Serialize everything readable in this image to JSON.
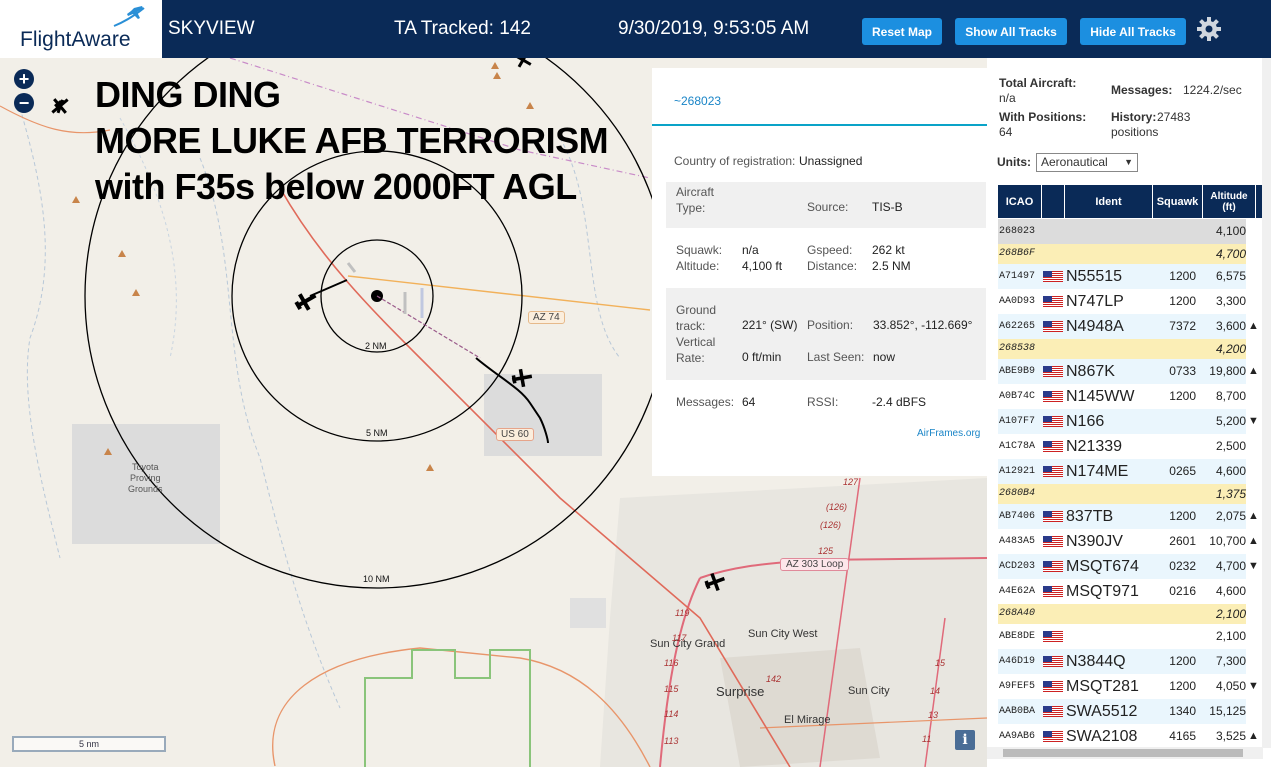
{
  "header": {
    "brand": "FlightAware",
    "title": "SKYVIEW",
    "ta_tracked": "TA Tracked: 142",
    "datetime": "9/30/2019, 9:53:05 AM",
    "buttons": {
      "reset": "Reset Map",
      "show": "Show All Tracks",
      "hide": "Hide All Tracks"
    }
  },
  "map": {
    "zoom_in": "+",
    "zoom_out": "−",
    "overlay": [
      "DING DING",
      "MORE LUKE AFB TERRORISM",
      "with F35s below 2000FT AGL"
    ],
    "range_rings": [
      "2 NM",
      "5 NM",
      "10 NM"
    ],
    "road_labels": [
      "AZ 74",
      "US 60",
      "AZ 303 Loop"
    ],
    "places": {
      "proving": "Toyota\nProving\nGrounds",
      "sun_city_grand": "Sun City Grand",
      "sun_city_west": "Sun City West",
      "surprise": "Surprise",
      "sun_city": "Sun City",
      "el_mirage": "El Mirage"
    },
    "road_numbers": [
      "127",
      "(126)",
      "(126)",
      "125",
      "119",
      "117",
      "116",
      "115",
      "114",
      "113",
      "142",
      "15",
      "14",
      "13",
      "12",
      "11"
    ],
    "scale": "5 nm",
    "info": "i"
  },
  "popup": {
    "icao": "~268023",
    "country_label": "Country of registration:",
    "country_value": "Unassigned",
    "aircraft_type_label": "Aircraft\nType:",
    "source_label": "Source:",
    "source_value": "TIS-B",
    "squawk_label": "Squawk:",
    "squawk_value": "n/a",
    "altitude_label": "Altitude:",
    "altitude_value": "4,100 ft",
    "gspeed_label": "Gspeed:",
    "gspeed_value": "262 kt",
    "distance_label": "Distance:",
    "distance_value": "2.5 NM",
    "ground_track_label": "Ground\ntrack:",
    "ground_track_value": "221° (SW)",
    "position_label": "Position:",
    "position_value": "33.852°, -112.669°",
    "vrate_label": "Vertical\nRate:",
    "vrate_value": "0 ft/min",
    "lastseen_label": "Last Seen:",
    "lastseen_value": "now",
    "messages_label": "Messages:",
    "messages_value": "64",
    "rssi_label": "RSSI:",
    "rssi_value": "-2.4 dBFS",
    "airframes": "AirFrames.org"
  },
  "stats": {
    "total_label": "Total Aircraft:",
    "total_value": "n/a",
    "messages_label": "Messages:",
    "messages_value": "1224.2/sec",
    "positions_label": "With Positions:",
    "positions_value": "64",
    "history_label": "History:",
    "history_value": "27483",
    "history_suffix": "positions",
    "units_label": "Units:",
    "units_value": "Aeronautical"
  },
  "table": {
    "headers": [
      "ICAO",
      "",
      "Ident",
      "Squawk",
      "Altitude\n(ft)"
    ],
    "rows": [
      {
        "icao": "268023",
        "flag": false,
        "ident": "",
        "squawk": "",
        "alt": "4,100",
        "trend": "",
        "style": "grey"
      },
      {
        "icao": "268B6F",
        "flag": false,
        "ident": "",
        "squawk": "",
        "alt": "4,700",
        "trend": "",
        "style": "mil"
      },
      {
        "icao": "A71497",
        "flag": true,
        "ident": "N55515",
        "squawk": "1200",
        "alt": "6,575",
        "trend": "",
        "style": "blue"
      },
      {
        "icao": "AA0D93",
        "flag": true,
        "ident": "N747LP",
        "squawk": "1200",
        "alt": "3,300",
        "trend": "",
        "style": "white"
      },
      {
        "icao": "A62265",
        "flag": true,
        "ident": "N4948A",
        "squawk": "7372",
        "alt": "3,600",
        "trend": "▲",
        "style": "blue"
      },
      {
        "icao": "268538",
        "flag": false,
        "ident": "",
        "squawk": "",
        "alt": "4,200",
        "trend": "",
        "style": "mil"
      },
      {
        "icao": "ABE9B9",
        "flag": true,
        "ident": "N867K",
        "squawk": "0733",
        "alt": "19,800",
        "trend": "▲",
        "style": "blue"
      },
      {
        "icao": "A0B74C",
        "flag": true,
        "ident": "N145WW",
        "squawk": "1200",
        "alt": "8,700",
        "trend": "",
        "style": "white"
      },
      {
        "icao": "A107F7",
        "flag": true,
        "ident": "N166",
        "squawk": "",
        "alt": "5,200",
        "trend": "▼",
        "style": "blue"
      },
      {
        "icao": "A1C78A",
        "flag": true,
        "ident": "N21339",
        "squawk": "",
        "alt": "2,500",
        "trend": "",
        "style": "white"
      },
      {
        "icao": "A12921",
        "flag": true,
        "ident": "N174ME",
        "squawk": "0265",
        "alt": "4,600",
        "trend": "",
        "style": "blue"
      },
      {
        "icao": "2680B4",
        "flag": false,
        "ident": "",
        "squawk": "",
        "alt": "1,375",
        "trend": "",
        "style": "mil"
      },
      {
        "icao": "AB7406",
        "flag": true,
        "ident": "837TB",
        "squawk": "1200",
        "alt": "2,075",
        "trend": "▲",
        "style": "blue"
      },
      {
        "icao": "A483A5",
        "flag": true,
        "ident": "N390JV",
        "squawk": "2601",
        "alt": "10,700",
        "trend": "▲",
        "style": "white"
      },
      {
        "icao": "ACD203",
        "flag": true,
        "ident": "MSQT674",
        "squawk": "0232",
        "alt": "4,700",
        "trend": "▼",
        "style": "blue"
      },
      {
        "icao": "A4E62A",
        "flag": true,
        "ident": "MSQT971",
        "squawk": "0216",
        "alt": "4,600",
        "trend": "",
        "style": "white"
      },
      {
        "icao": "268A40",
        "flag": false,
        "ident": "",
        "squawk": "",
        "alt": "2,100",
        "trend": "",
        "style": "mil"
      },
      {
        "icao": "ABE8DE",
        "flag": true,
        "ident": "",
        "squawk": "",
        "alt": "2,100",
        "trend": "",
        "style": "white"
      },
      {
        "icao": "A46D19",
        "flag": true,
        "ident": "N3844Q",
        "squawk": "1200",
        "alt": "7,300",
        "trend": "",
        "style": "blue"
      },
      {
        "icao": "A9FEF5",
        "flag": true,
        "ident": "MSQT281",
        "squawk": "1200",
        "alt": "4,050",
        "trend": "▼",
        "style": "white"
      },
      {
        "icao": "AAB0BA",
        "flag": true,
        "ident": "SWA5512",
        "squawk": "1340",
        "alt": "15,125",
        "trend": "",
        "style": "blue"
      },
      {
        "icao": "AA9AB6",
        "flag": true,
        "ident": "SWA2108",
        "squawk": "4165",
        "alt": "3,525",
        "trend": "▲",
        "style": "white"
      }
    ]
  }
}
